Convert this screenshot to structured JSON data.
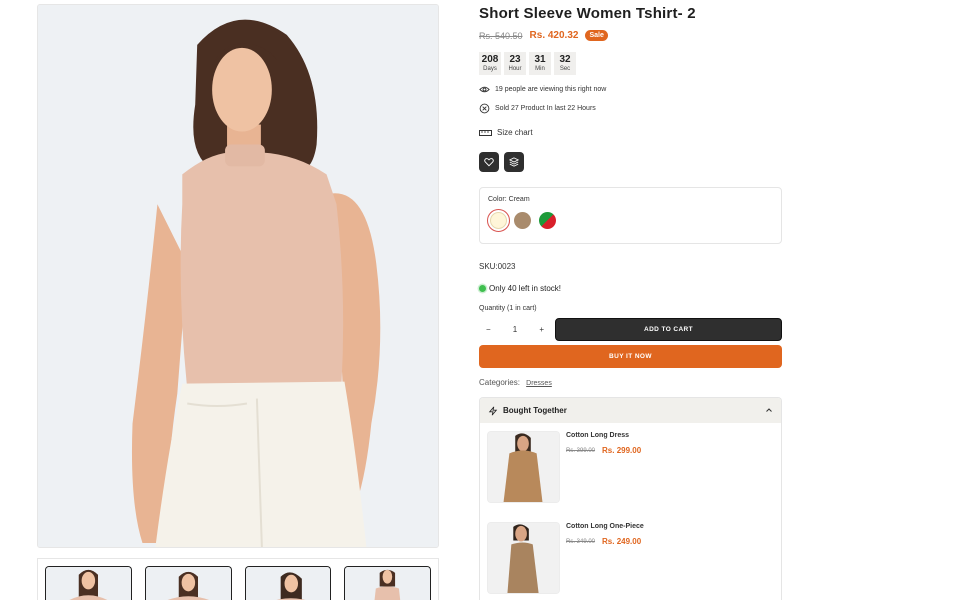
{
  "product": {
    "title": "Short Sleeve Women Tshirt- 2",
    "price_old": "Rs. 540.50",
    "price_new": "Rs. 420.32",
    "sale_badge": "Sale"
  },
  "countdown": [
    {
      "value": "208",
      "label": "Days"
    },
    {
      "value": "23",
      "label": "Hour"
    },
    {
      "value": "31",
      "label": "Min"
    },
    {
      "value": "32",
      "label": "Sec"
    }
  ],
  "viewing_text": "19 people are viewing this right now",
  "sold_text": "Sold 27 Product In last 22 Hours",
  "size_chart_label": "Size chart",
  "color": {
    "label": "Color:",
    "selected": "Cream",
    "swatches": [
      {
        "name": "Cream",
        "hex": "#fff6d9"
      },
      {
        "name": "Brown",
        "hex": "#a98b6c"
      },
      {
        "name": "Red/Green",
        "hex": "#d8202a"
      }
    ]
  },
  "sku": "SKU:0023",
  "stock_text": "Only 40 left in stock!",
  "quantity": {
    "label": "Quantity",
    "in_cart": "(1 in cart)",
    "value": "1",
    "minus": "−",
    "plus": "+"
  },
  "add_to_cart_label": "ADD TO CART",
  "buy_now_label": "BUY IT NOW",
  "categories": {
    "label": "Categories:",
    "link": "Dresses"
  },
  "bought_together": {
    "title": "Bought Together",
    "items": [
      {
        "name": "Cotton Long Dress",
        "price_old": "Rs. 399.00",
        "price_new": "Rs. 299.00"
      },
      {
        "name": "Cotton Long One-Piece",
        "price_old": "Rs. 349.00",
        "price_new": "Rs. 249.00"
      }
    ]
  },
  "colors": {
    "accent": "#e0661f",
    "dark_button": "#2f2f2f",
    "sale": "#e0661f"
  }
}
